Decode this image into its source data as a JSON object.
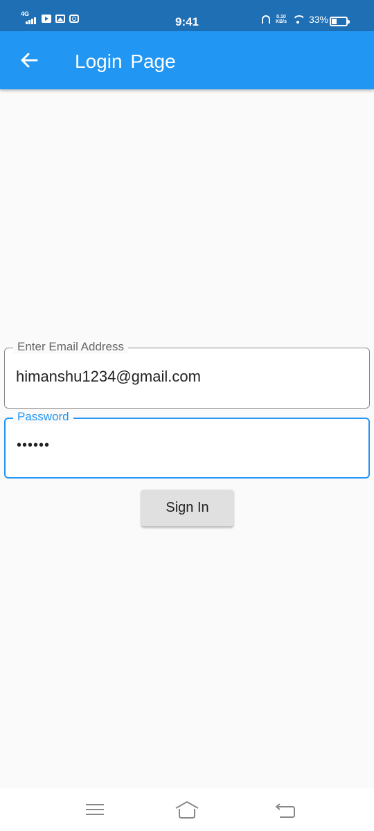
{
  "status_bar": {
    "network": "4G",
    "time": "9:41",
    "speed_value": "0.10",
    "speed_unit": "KB/s",
    "battery": "33%",
    "battery_level": 0.33
  },
  "app_bar": {
    "title": "Login  Page"
  },
  "form": {
    "email": {
      "label": "Enter Email Address",
      "value": "himanshu1234@gmail.com"
    },
    "password": {
      "label": "Password",
      "value": "••••••"
    },
    "submit_label": "Sign In"
  },
  "colors": {
    "status_bar": "#1f6fb5",
    "app_bar": "#2196f3",
    "focus": "#2196f3",
    "background": "#fafafa",
    "button": "#e0e0e0"
  }
}
